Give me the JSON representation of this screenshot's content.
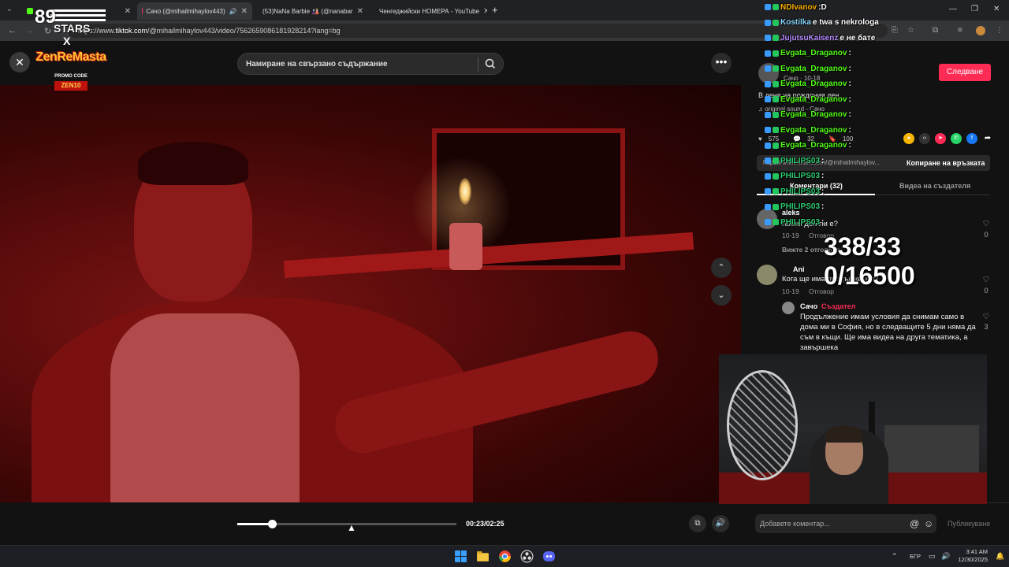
{
  "browser": {
    "tabs": [
      {
        "label": "",
        "favicon": "kick-icon",
        "color": "#53fc18"
      },
      {
        "label": "Сачо (@mihailmihaylov443)",
        "favicon": "tiktok-icon",
        "color": "#fe2c55"
      },
      {
        "label": "(53)NaNa Barbie 🎎 (@nanabar",
        "favicon": "tiktok-icon",
        "color": "#fe2c55"
      },
      {
        "label": "Ченгеджийски НОМЕРА - YouTube",
        "favicon": "youtube-icon",
        "color": "#ff0000"
      }
    ],
    "new_tab": "+",
    "url_prefix": "https://www.",
    "url_domain": "tiktok.com",
    "url_rest": "/@mihailmihaylov443/video/7562659086181928214?lang=bg"
  },
  "overlay": {
    "stars_number": "89",
    "stars_text": "STARS",
    "stars_x": "X",
    "logo_title": "ZenReMasta",
    "logo_promo": "PROMO CODE",
    "logo_code": "ZEN10",
    "counter_line1": "338/33",
    "counter_line2": "0/16500"
  },
  "tiktok": {
    "search_placeholder": "Намиране на свързано съдържание",
    "close_label": "✕",
    "more_label": "•••",
    "time": "00:23/02:25",
    "progress": 0.16,
    "follow_label": "Следване",
    "author_line": "Сачо · 10-18",
    "caption": "В деня на рождения ден",
    "sound": "♫ original sound - Сачо",
    "likes": "575",
    "comments_count": "32",
    "saves": "100",
    "link_text": "https://www.tiktok.com/@mihailmihaylov...",
    "copy_link_label": "Копиране на връзката",
    "tab_comments": "Коментари (32)",
    "tab_creator": "Видеа на създателя",
    "comments": [
      {
        "name": "aleks",
        "text": "голям ден ли е?",
        "date": "10-19",
        "reply": "Отговор",
        "likes": "0",
        "more": "Вижте 2 отговора"
      },
      {
        "name": "Ani",
        "text": "Кога ще има продължение?",
        "date": "10-19",
        "reply": "Отговор",
        "likes": "0"
      }
    ],
    "creator_reply": {
      "name": "Сачо",
      "tag": "Създател",
      "text": "Продължение имам условия да снимам само в дома ми в София, но в следващите 5 дни няма да съм в къщи. Ще има видеа на друга тематика, а завършека",
      "likes": "3"
    },
    "comment_placeholder": "Добавете коментар...",
    "post_label": "Публикуване"
  },
  "chat": [
    {
      "user": "NDIvanov",
      "msg": ":D",
      "color": "#ffb200"
    },
    {
      "user": "Kostilka",
      "msg": "е twa s nekrologa",
      "color": "#8ad8ff"
    },
    {
      "user": "JujutsuKaisenz",
      "msg": "е не бате",
      "color": "#b68cff"
    },
    {
      "user": "Evgata_Draganov",
      "msg": ":",
      "color": "#53fc18"
    },
    {
      "user": "Evgata_Draganov",
      "msg": ":",
      "color": "#53fc18"
    },
    {
      "user": "Evgata_Draganov",
      "msg": ":",
      "color": "#53fc18"
    },
    {
      "user": "Evgata_Draganov",
      "msg": ":",
      "color": "#53fc18"
    },
    {
      "user": "Evgata_Draganov",
      "msg": ":",
      "color": "#53fc18"
    },
    {
      "user": "Evgata_Draganov",
      "msg": ":",
      "color": "#53fc18"
    },
    {
      "user": "Evgata_Draganov",
      "msg": ":",
      "color": "#53fc18"
    },
    {
      "user": "PHILIPS03",
      "msg": ":",
      "color": "#2ecc71"
    },
    {
      "user": "PHILIPS03",
      "msg": ":",
      "color": "#2ecc71"
    },
    {
      "user": "PHILIPS03",
      "msg": ":",
      "color": "#2ecc71"
    },
    {
      "user": "PHILIPS03",
      "msg": ":",
      "color": "#2ecc71"
    },
    {
      "user": "PHILIPS03",
      "msg": ":",
      "color": "#2ecc71"
    }
  ],
  "taskbar": {
    "lang": "БГР",
    "time": "3:41 AM",
    "date": "12/30/2025"
  }
}
